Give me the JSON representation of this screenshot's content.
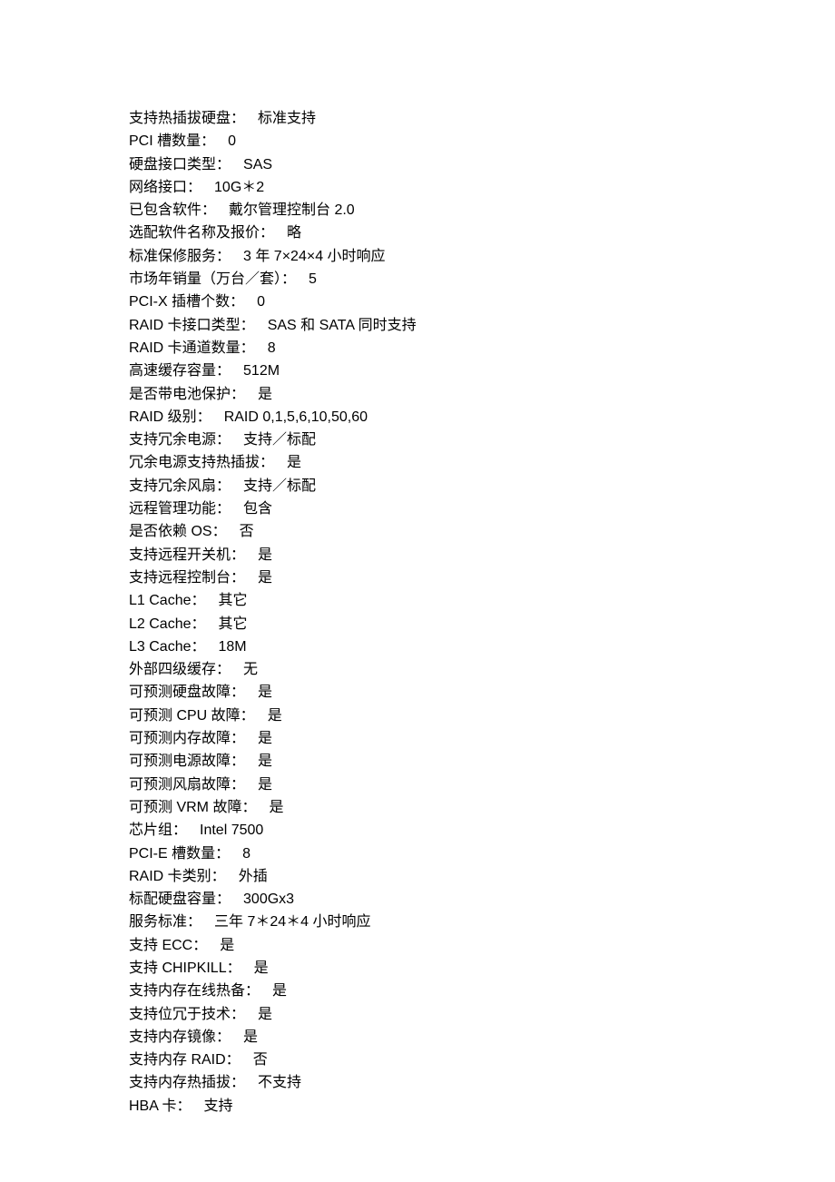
{
  "specs": [
    {
      "label": "支持热插拔硬盘：",
      "value": "标准支持"
    },
    {
      "label": "PCI 槽数量：",
      "value": "0"
    },
    {
      "label": "硬盘接口类型：",
      "value": "SAS"
    },
    {
      "label": "网络接口：",
      "value": "10G＊2"
    },
    {
      "label": "已包含软件：",
      "value": "戴尔管理控制台 2.0"
    },
    {
      "label": "选配软件名称及报价：",
      "value": "略"
    },
    {
      "label": "标准保修服务：",
      "value": "3 年 7×24×4 小时响应"
    },
    {
      "label": "市场年销量（万台／套）：",
      "value": "5"
    },
    {
      "label": "PCI-X 插槽个数：",
      "value": "0"
    },
    {
      "label": "RAID 卡接口类型：",
      "value": "SAS 和 SATA 同时支持"
    },
    {
      "label": "RAID 卡通道数量：",
      "value": "8"
    },
    {
      "label": "高速缓存容量：",
      "value": "512M"
    },
    {
      "label": "是否带电池保护：",
      "value": "是"
    },
    {
      "label": "RAID 级别：",
      "value": "RAID 0,1,5,6,10,50,60"
    },
    {
      "label": "支持冗余电源：",
      "value": "支持／标配"
    },
    {
      "label": "冗余电源支持热插拔：",
      "value": "是"
    },
    {
      "label": "支持冗余风扇：",
      "value": "支持／标配"
    },
    {
      "label": "远程管理功能：",
      "value": "包含"
    },
    {
      "label": "是否依赖 OS：",
      "value": "否"
    },
    {
      "label": "支持远程开关机：",
      "value": "是"
    },
    {
      "label": "支持远程控制台：",
      "value": "是"
    },
    {
      "label": "L1 Cache：",
      "value": "其它"
    },
    {
      "label": "L2 Cache：",
      "value": "其它"
    },
    {
      "label": "L3 Cache：",
      "value": "18M"
    },
    {
      "label": "外部四级缓存：",
      "value": "无"
    },
    {
      "label": "可预测硬盘故障：",
      "value": "是"
    },
    {
      "label": "可预测 CPU 故障：",
      "value": "是"
    },
    {
      "label": "可预测内存故障：",
      "value": "是"
    },
    {
      "label": "可预测电源故障：",
      "value": "是"
    },
    {
      "label": "可预测风扇故障：",
      "value": "是"
    },
    {
      "label": "可预测 VRM 故障：",
      "value": "是"
    },
    {
      "label": "芯片组：",
      "value": "Intel 7500"
    },
    {
      "label": "PCI-E 槽数量：",
      "value": "8"
    },
    {
      "label": "RAID 卡类别：",
      "value": "外插"
    },
    {
      "label": "标配硬盘容量：",
      "value": "300Gx3"
    },
    {
      "label": "服务标准：",
      "value": "三年 7＊24＊4 小时响应"
    },
    {
      "label": "支持 ECC：",
      "value": "是"
    },
    {
      "label": "支持 CHIPKILL：",
      "value": "是"
    },
    {
      "label": "支持内存在线热备：",
      "value": "是"
    },
    {
      "label": "支持位冗于技术：",
      "value": "是"
    },
    {
      "label": "支持内存镜像：",
      "value": "是"
    },
    {
      "label": "支持内存 RAID：",
      "value": "否"
    },
    {
      "label": "支持内存热插拔：",
      "value": "不支持"
    },
    {
      "label": "HBA 卡：",
      "value": "支持"
    }
  ]
}
